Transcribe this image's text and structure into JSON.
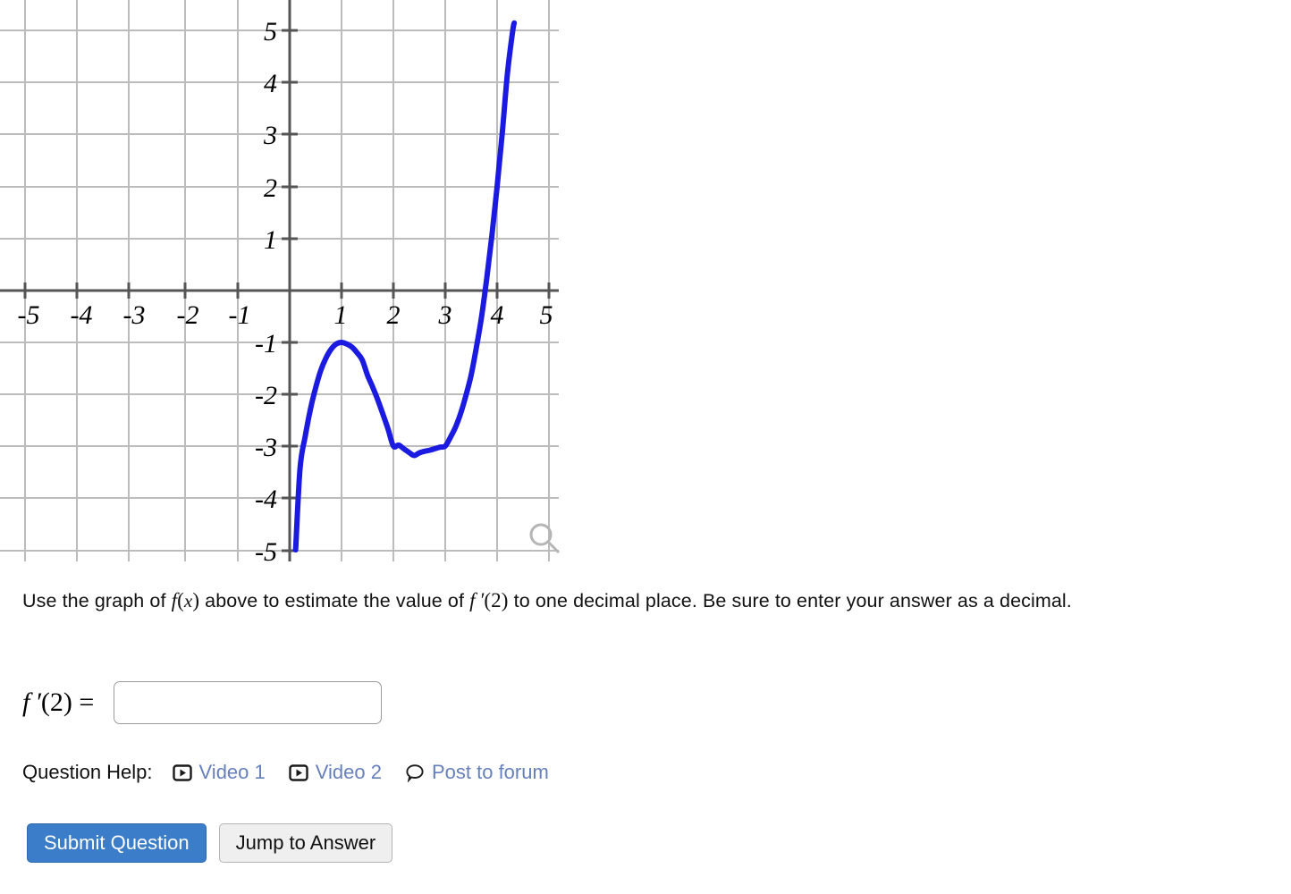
{
  "chart_data": {
    "type": "line",
    "title": "",
    "xlabel": "",
    "ylabel": "",
    "xlim": [
      -5.2,
      5.2
    ],
    "ylim": [
      -5.2,
      5.2
    ],
    "grid": true,
    "legend": "none",
    "xticks": [
      "-5",
      "-4",
      "-3",
      "-2",
      "-1",
      "1",
      "2",
      "3",
      "4",
      "5"
    ],
    "yticks": [
      "5",
      "4",
      "3",
      "2",
      "1",
      "-1",
      "-2",
      "-3",
      "-4",
      "-5"
    ],
    "series": [
      {
        "name": "f(x)",
        "color": "#1a1ae0",
        "comment": "cubic f(x) = x^3 - 6x^2 + 9x - 5 ; drawn only where |y| <= 5",
        "x": [
          0.115,
          0.2,
          0.3,
          0.4,
          0.5,
          0.6,
          0.7,
          0.8,
          0.9,
          1.0,
          1.1,
          1.2,
          1.3,
          1.4,
          1.5,
          1.6,
          1.7,
          1.8,
          1.9,
          2.0,
          2.1,
          2.2,
          2.3,
          2.4,
          2.5,
          2.6,
          2.7,
          2.8,
          2.9,
          3.0,
          3.1,
          3.2,
          3.3,
          3.4,
          3.5,
          3.6,
          3.7,
          3.8,
          3.9,
          4.0,
          4.1,
          4.2,
          4.3,
          4.33
        ],
        "y": [
          -5.0,
          -3.43,
          -2.81,
          -2.29,
          -1.88,
          -1.54,
          -1.3,
          -1.13,
          -1.03,
          -1.0,
          -1.03,
          -1.09,
          -1.2,
          -1.34,
          -1.63,
          -1.86,
          -2.11,
          -2.39,
          -2.68,
          -3.0,
          -2.98,
          -3.05,
          -3.12,
          -3.18,
          -3.13,
          -3.1,
          -3.08,
          -3.05,
          -3.02,
          -3.0,
          -2.83,
          -2.63,
          -2.36,
          -2.02,
          -1.63,
          -1.1,
          -0.51,
          0.23,
          1.06,
          2.0,
          3.04,
          4.19,
          5.0,
          5.16
        ]
      }
    ]
  },
  "graph": {
    "zoom_icon": "magnifier-icon",
    "axis_color": "#555555",
    "grid_color": "#b9b9b9",
    "curve_color": "#1a1ae0"
  },
  "prompt": {
    "part1": "Use the graph of ",
    "fx": "f",
    "fx_arg": "(x)",
    "part2": " above to estimate the value of ",
    "fprime": "f ′",
    "fprime_arg": "(2)",
    "part3": " to one decimal place. Be sure to enter your answer as a decimal."
  },
  "answer": {
    "label_f": "f ′",
    "label_arg": "(2)",
    "label_eq": "=",
    "value": "",
    "placeholder": ""
  },
  "question_help": {
    "label": "Question Help:",
    "links": [
      {
        "icon": "video-play-icon",
        "label": "Video 1"
      },
      {
        "icon": "video-play-icon",
        "label": "Video 2"
      },
      {
        "icon": "speech-bubble-icon",
        "label": "Post to forum"
      }
    ],
    "link_color": "#6680bb"
  },
  "buttons": {
    "submit": "Submit Question",
    "jump": "Jump to Answer",
    "submit_color": "#3b7dc8",
    "jump_color": "#efefef"
  }
}
